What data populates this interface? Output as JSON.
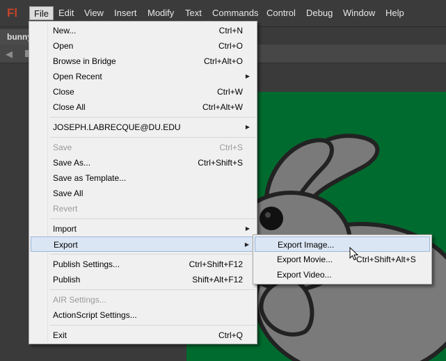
{
  "app": {
    "logo": "Fl"
  },
  "menubar": {
    "items": [
      {
        "label": "File",
        "active": true
      },
      {
        "label": "Edit"
      },
      {
        "label": "View"
      },
      {
        "label": "Insert"
      },
      {
        "label": "Modify"
      },
      {
        "label": "Text"
      },
      {
        "label": "Commands"
      },
      {
        "label": "Control"
      },
      {
        "label": "Debug"
      },
      {
        "label": "Window"
      },
      {
        "label": "Help"
      }
    ]
  },
  "document": {
    "tab_label": "bunny"
  },
  "file_menu": {
    "items": [
      {
        "label": "New...",
        "shortcut": "Ctrl+N"
      },
      {
        "label": "Open",
        "shortcut": "Ctrl+O"
      },
      {
        "label": "Browse in Bridge",
        "shortcut": "Ctrl+Alt+O"
      },
      {
        "label": "Open Recent",
        "shortcut": "",
        "submenu": true
      },
      {
        "label": "Close",
        "shortcut": "Ctrl+W"
      },
      {
        "label": "Close All",
        "shortcut": "Ctrl+Alt+W"
      },
      {
        "label": "JOSEPH.LABRECQUE@DU.EDU",
        "shortcut": "",
        "submenu": true
      },
      {
        "label": "Save",
        "shortcut": "Ctrl+S",
        "disabled": true
      },
      {
        "label": "Save As...",
        "shortcut": "Ctrl+Shift+S"
      },
      {
        "label": "Save as Template...",
        "shortcut": ""
      },
      {
        "label": "Save All",
        "shortcut": ""
      },
      {
        "label": "Revert",
        "shortcut": "",
        "disabled": true
      },
      {
        "label": "Import",
        "shortcut": "",
        "submenu": true
      },
      {
        "label": "Export",
        "shortcut": "",
        "submenu": true,
        "highlight": true
      },
      {
        "label": "Publish Settings...",
        "shortcut": "Ctrl+Shift+F12"
      },
      {
        "label": "Publish",
        "shortcut": "Shift+Alt+F12"
      },
      {
        "label": "AIR Settings...",
        "shortcut": "",
        "disabled": true
      },
      {
        "label": "ActionScript Settings...",
        "shortcut": ""
      },
      {
        "label": "Exit",
        "shortcut": "Ctrl+Q"
      }
    ]
  },
  "export_submenu": {
    "items": [
      {
        "label": "Export Image...",
        "shortcut": "",
        "highlight": true
      },
      {
        "label": "Export Movie...",
        "shortcut": "Ctrl+Shift+Alt+S"
      },
      {
        "label": "Export Video...",
        "shortcut": ""
      }
    ]
  },
  "colors": {
    "stage": "#006b2e",
    "menu_bg": "#f0f0f0",
    "highlight": "#dbe6f4",
    "bunny": "#7a7a7a"
  }
}
